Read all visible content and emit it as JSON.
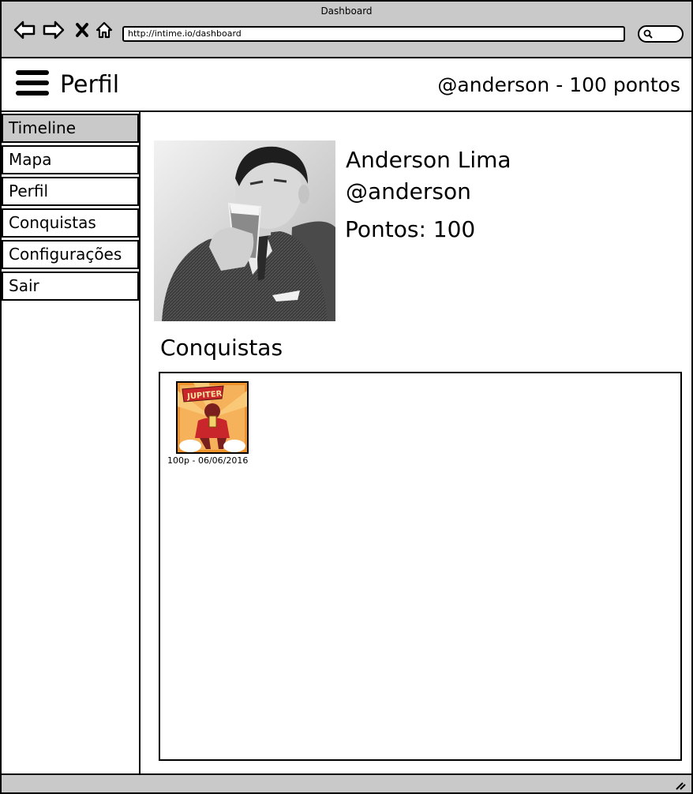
{
  "window": {
    "title": "Dashboard"
  },
  "browser": {
    "url": "http://intime.io/dashboard",
    "icons": [
      "back-icon",
      "forward-icon",
      "stop-icon",
      "home-icon",
      "search-icon"
    ]
  },
  "header": {
    "menu_icon": "menu-icon",
    "title": "Perfil",
    "user_status": "@anderson - 100 pontos"
  },
  "sidebar": {
    "items": [
      {
        "label": "Timeline",
        "active": true
      },
      {
        "label": "Mapa",
        "active": false
      },
      {
        "label": "Perfil",
        "active": false
      },
      {
        "label": "Conquistas",
        "active": false
      },
      {
        "label": "Configurações",
        "active": false
      },
      {
        "label": "Sair",
        "active": false
      }
    ]
  },
  "profile": {
    "name": "Anderson Lima",
    "handle": "@anderson",
    "points_label": "Pontos: 100"
  },
  "achievements": {
    "title": "Conquistas",
    "items": [
      {
        "badge_text": "JUPITER",
        "caption": "100p - 06/06/2016"
      }
    ]
  },
  "colors": {
    "chrome": "#c9c9c9",
    "active_item": "#c9c9c9",
    "badge_orange": "#f0922b",
    "badge_red": "#c8262a"
  }
}
